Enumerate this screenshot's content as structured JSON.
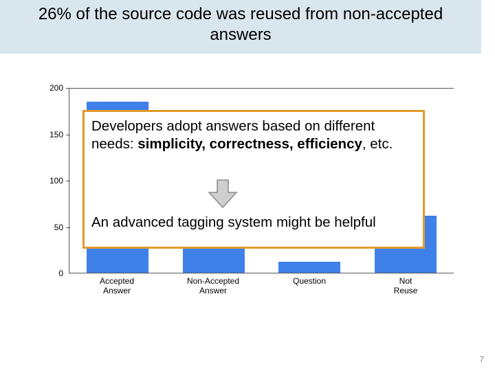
{
  "title": "26% of the source code was reused from non-accepted answers",
  "chart_data": {
    "type": "bar",
    "categories": [
      "Accepted Answer",
      "Non-Accepted Answer",
      "Question",
      "Not Reuse"
    ],
    "values": [
      185,
      66,
      12,
      62
    ],
    "title": "",
    "xlabel": "",
    "ylabel": "",
    "ylim": [
      0,
      200
    ],
    "yticks": [
      0,
      50,
      100,
      150,
      200
    ]
  },
  "callout": {
    "pre": "Developers adopt answers based on different needs: ",
    "bold": "simplicity, correctness, efficiency",
    "post": ", etc.",
    "line2": "An advanced tagging system might be helpful"
  },
  "page_number": "7",
  "colors": {
    "bar": "#3f80e9",
    "callout_border": "#e39a2b",
    "title_bg": "#d9e6ee"
  }
}
